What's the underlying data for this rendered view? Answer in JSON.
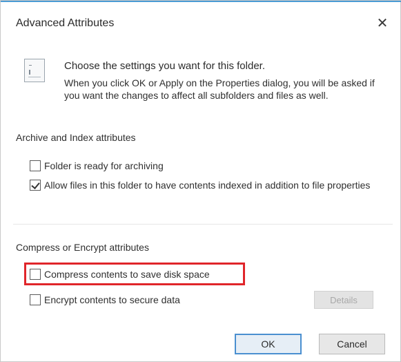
{
  "window": {
    "title": "Advanced Attributes",
    "close_glyph": "✕"
  },
  "intro": {
    "title": "Choose the settings you want for this folder.",
    "description": "When you click OK or Apply on the Properties dialog, you will be asked if you want the changes to affect all subfolders and files as well."
  },
  "archive_group": {
    "label": "Archive and Index attributes",
    "options": [
      {
        "label": "Folder is ready for archiving",
        "checked": false
      },
      {
        "label": "Allow files in this folder to have contents indexed in addition to file properties",
        "checked": true
      }
    ]
  },
  "compress_group": {
    "label": "Compress or Encrypt attributes",
    "options": [
      {
        "label": "Compress contents to save disk space",
        "checked": false,
        "highlighted": true
      },
      {
        "label": "Encrypt contents to secure data",
        "checked": false
      }
    ],
    "details_label": "Details"
  },
  "footer": {
    "ok_label": "OK",
    "cancel_label": "Cancel"
  },
  "colors": {
    "accent": "#4a9bd4",
    "highlight": "#e0252a"
  }
}
